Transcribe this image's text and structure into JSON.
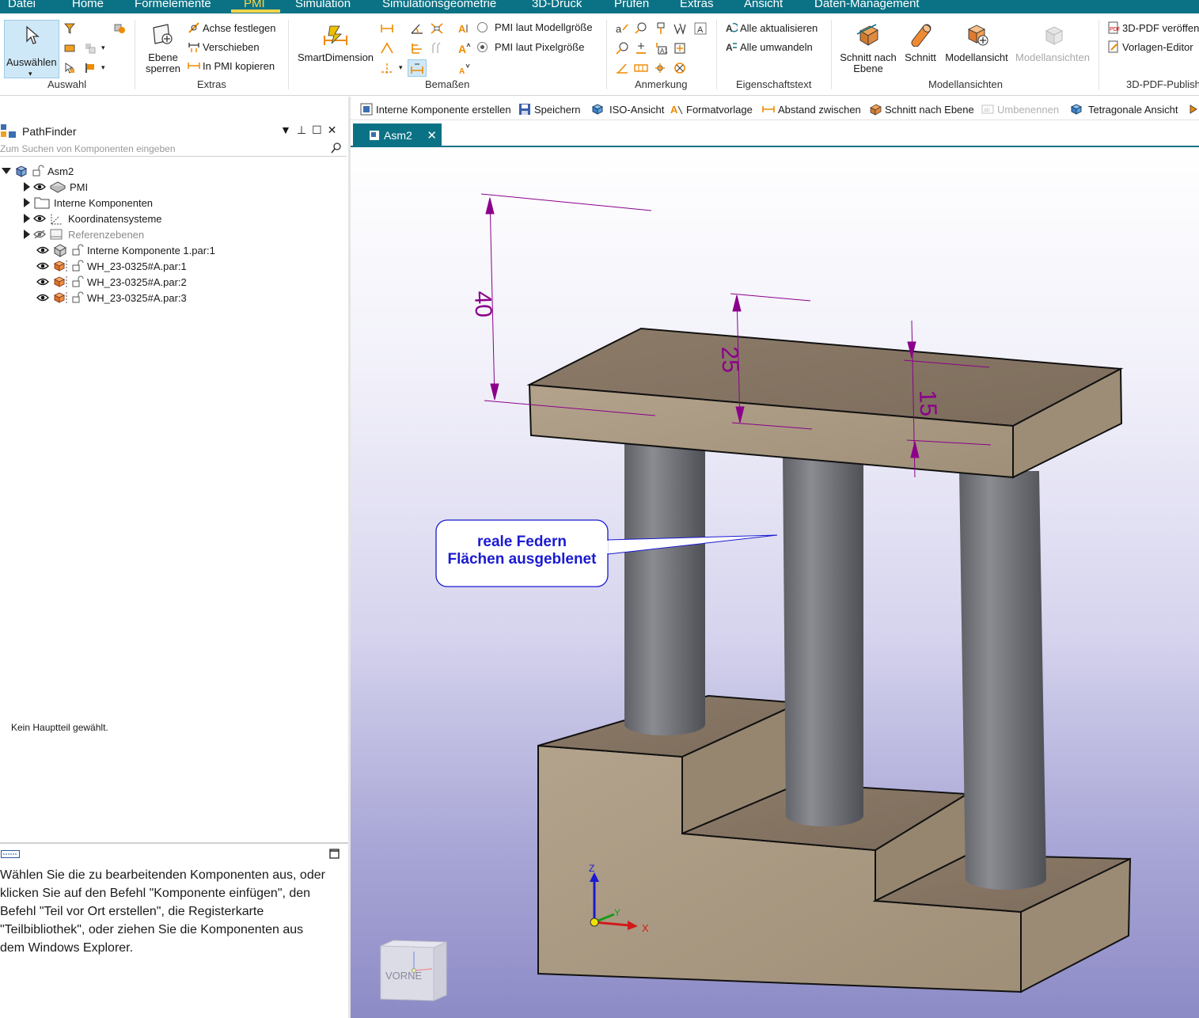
{
  "menu": {
    "items": [
      "Datei",
      "Home",
      "Formelemente",
      "PMI",
      "Simulation",
      "Simulationsgeometrie",
      "3D-Druck",
      "Prüfen",
      "Extras",
      "Ansicht",
      "Daten-Management"
    ],
    "active": "PMI"
  },
  "ribbon": {
    "auswahl": {
      "select_label": "Auswählen",
      "group_label": "Auswahl"
    },
    "extras": {
      "plane_lock_label": "Ebene sperren",
      "set_axis": "Achse festlegen",
      "move": "Verschieben",
      "copy_to_pmi": "In PMI kopieren",
      "group_label": "Extras"
    },
    "bemassen": {
      "smart_dimension": "SmartDimension",
      "pmi_model_size": "PMI laut Modellgröße",
      "pmi_pixel_size": "PMI laut Pixelgröße",
      "pmi_size_selected": "PMI laut Pixelgröße",
      "group_label": "Bemaßen"
    },
    "anmerkung": {
      "group_label": "Anmerkung"
    },
    "eigenschaftstext": {
      "update_all": "Alle aktualisieren",
      "convert_all": "Alle umwandeln",
      "group_label": "Eigenschaftstext"
    },
    "modellansichten": {
      "section_by_plane": "Schnitt nach Ebene",
      "section": "Schnitt",
      "model_view": "Modellansicht",
      "model_views": "Modellansichten",
      "group_label": "Modellansichten"
    },
    "pdf": {
      "publish": "3D-PDF veröffen",
      "template_editor": "Vorlagen-Editor",
      "group_label": "3D-PDF-Publish"
    }
  },
  "pathfinder": {
    "title": "PathFinder",
    "search_placeholder": "Zum Suchen von Komponenten eingeben",
    "tree": [
      {
        "label": "Asm2",
        "level": 0,
        "expanded": true,
        "eye": false
      },
      {
        "label": "PMI",
        "level": 1,
        "expanded": false,
        "eye": true
      },
      {
        "label": "Interne Komponenten",
        "level": 1,
        "expanded": false,
        "eye": false
      },
      {
        "label": "Koordinatensysteme",
        "level": 1,
        "expanded": false,
        "eye": true
      },
      {
        "label": "Referenzebenen",
        "level": 1,
        "expanded": false,
        "eye": "hidden",
        "dimmed": true
      },
      {
        "label": "Interne Komponente 1.par:1",
        "level": 2,
        "eye": true
      },
      {
        "label": "WH_23-0325#A.par:1",
        "level": 2,
        "eye": true
      },
      {
        "label": "WH_23-0325#A.par:2",
        "level": 2,
        "eye": true
      },
      {
        "label": "WH_23-0325#A.par:3",
        "level": 2,
        "eye": true
      }
    ],
    "status": "Kein Hauptteil gewählt."
  },
  "help": {
    "lines": [
      "Wählen Sie die zu bearbeitenden Komponenten aus, oder",
      "klicken Sie auf den Befehl \"Komponente einfügen\", den",
      "Befehl \"Teil vor Ort erstellen\", die Registerkarte",
      "\"Teilbibliothek\", oder ziehen Sie die Komponenten aus",
      "dem Windows Explorer."
    ]
  },
  "quickbar": {
    "items": [
      "Interne Komponente erstellen",
      "Speichern",
      "ISO-Ansicht",
      "Formatvorlage",
      "Abstand zwischen",
      "Schnitt nach Ebene",
      "Umbenennen",
      "Tetragonale Ansicht"
    ],
    "disabled": [
      "Umbenennen"
    ]
  },
  "document": {
    "tab": "Asm2"
  },
  "viewport": {
    "dimensions": [
      "40",
      "25",
      "15"
    ],
    "callout": [
      "reale Federn",
      "Flächen ausgeblenet"
    ],
    "axes": {
      "x": "X",
      "y": "Y",
      "z": "Z"
    },
    "view_cube": "VORNE"
  },
  "colors": {
    "menubar": "#0b7285",
    "active_menu": "#ffd54a",
    "dimension": "#8b008b",
    "callout_text": "#1a1ad2",
    "part_top": "#8a7866",
    "part_side": "#a89882",
    "cylinder": "#6d6f75"
  }
}
